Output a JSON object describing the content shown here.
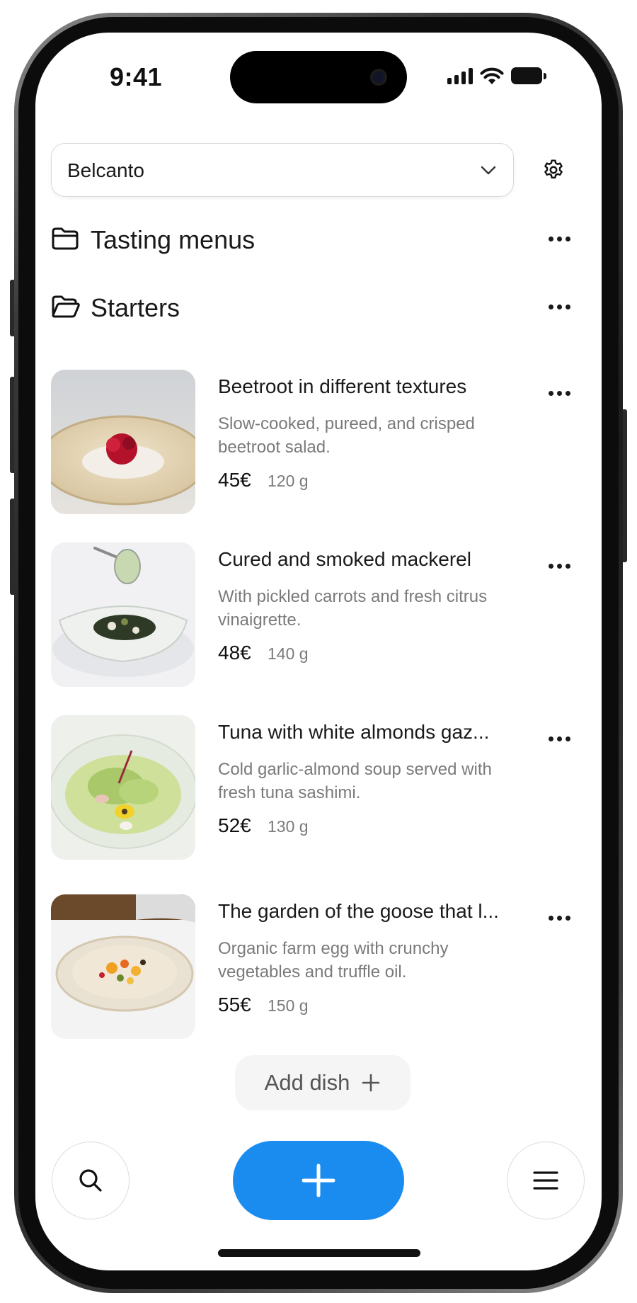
{
  "status_bar": {
    "time": "9:41"
  },
  "header": {
    "restaurant_select": {
      "value": "Belcanto",
      "icon": "chevron-down-icon"
    },
    "settings_icon": "gear-icon"
  },
  "categories": [
    {
      "label": "Tasting menus",
      "icon": "folder-closed-icon",
      "expanded": false
    },
    {
      "label": "Starters",
      "icon": "folder-open-icon",
      "expanded": true
    }
  ],
  "dishes": [
    {
      "name": "Beetroot in different textures",
      "description": "Slow-cooked, pureed, and crisped beetroot salad.",
      "price": "45€",
      "weight": "120 g"
    },
    {
      "name": "Cured and smoked mackerel",
      "description": "With pickled carrots and fresh citrus vinaigrette.",
      "price": "48€",
      "weight": "140 g"
    },
    {
      "name": "Tuna with white almonds gaz...",
      "description": "Cold garlic-almond soup served with fresh tuna sashimi.",
      "price": "52€",
      "weight": "130 g"
    },
    {
      "name": "The garden of the goose that l...",
      "description": "Organic farm egg with crunchy vegetables and truffle oil.",
      "price": "55€",
      "weight": "150 g"
    }
  ],
  "add_dish": {
    "label": "Add dish",
    "icon": "plus-icon"
  },
  "bottom_bar": {
    "search_icon": "search-icon",
    "add_icon": "plus-icon",
    "menu_icon": "hamburger-menu-icon"
  },
  "colors": {
    "accent": "#1a8cf0",
    "text_primary": "#1a1a1a",
    "text_secondary": "#7a7a7a",
    "add_dish_bg": "#f5f5f5"
  }
}
